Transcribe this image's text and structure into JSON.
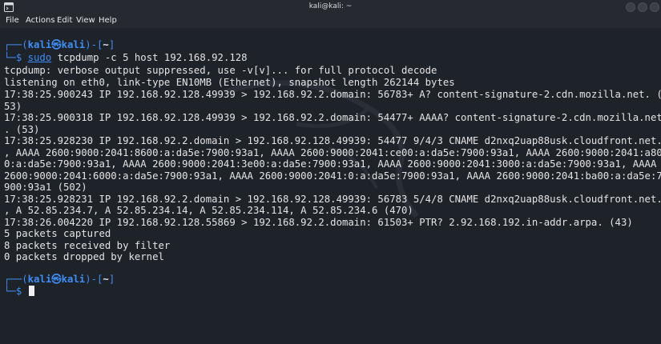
{
  "window": {
    "title": "kali@kali: ~"
  },
  "menu": [
    "File",
    "Actions",
    "Edit",
    "View",
    "Help"
  ],
  "prompt1": {
    "top_open": "┌──(",
    "user": "kali",
    "at_sym": "㉿",
    "host": "kali",
    "mid": ")-[",
    "path": "~",
    "close": "]",
    "bottom": "└─",
    "dollar": "$ ",
    "sudo": "sudo",
    "command": " tcpdump -c 5 host 192.168.92.128"
  },
  "output": [
    "tcpdump: verbose output suppressed, use -v[v]... for full protocol decode",
    "listening on eth0, link-type EN10MB (Ethernet), snapshot length 262144 bytes",
    "17:38:25.900243 IP 192.168.92.128.49939 > 192.168.92.2.domain: 56783+ A? content-signature-2.cdn.mozilla.net. (",
    "53)",
    "17:38:25.900318 IP 192.168.92.128.49939 > 192.168.92.2.domain: 54477+ AAAA? content-signature-2.cdn.mozilla.net",
    ". (53)",
    "17:38:25.928230 IP 192.168.92.2.domain > 192.168.92.128.49939: 54477 9/4/3 CNAME d2nxq2uap88usk.cloudfront.net.",
    ", AAAA 2600:9000:2041:8600:a:da5e:7900:93a1, AAAA 2600:9000:2041:ce00:a:da5e:7900:93a1, AAAA 2600:9000:2041:a80",
    "0:a:da5e:7900:93a1, AAAA 2600:9000:2041:3e00:a:da5e:7900:93a1, AAAA 2600:9000:2041:3000:a:da5e:7900:93a1, AAAA",
    "2600:9000:2041:6000:a:da5e:7900:93a1, AAAA 2600:9000:2041:0:a:da5e:7900:93a1, AAAA 2600:9000:2041:ba00:a:da5e:7",
    "900:93a1 (502)",
    "17:38:25.928231 IP 192.168.92.2.domain > 192.168.92.128.49939: 56783 5/4/8 CNAME d2nxq2uap88usk.cloudfront.net.",
    ", A 52.85.234.7, A 52.85.234.14, A 52.85.234.114, A 52.85.234.6 (470)",
    "17:38:26.004220 IP 192.168.92.128.55869 > 192.168.92.2.domain: 61503+ PTR? 2.92.168.192.in-addr.arpa. (43)",
    "5 packets captured",
    "8 packets received by filter",
    "0 packets dropped by kernel"
  ],
  "prompt2": {
    "top_open": "┌──(",
    "user": "kali",
    "at_sym": "㉿",
    "host": "kali",
    "mid": ")-[",
    "path": "~",
    "close": "]",
    "bottom": "└─",
    "dollar": "$ "
  },
  "colors": {
    "background": "#1e2229",
    "prompt_blue": "#3d8ef5",
    "text": "#e4e4e4"
  }
}
